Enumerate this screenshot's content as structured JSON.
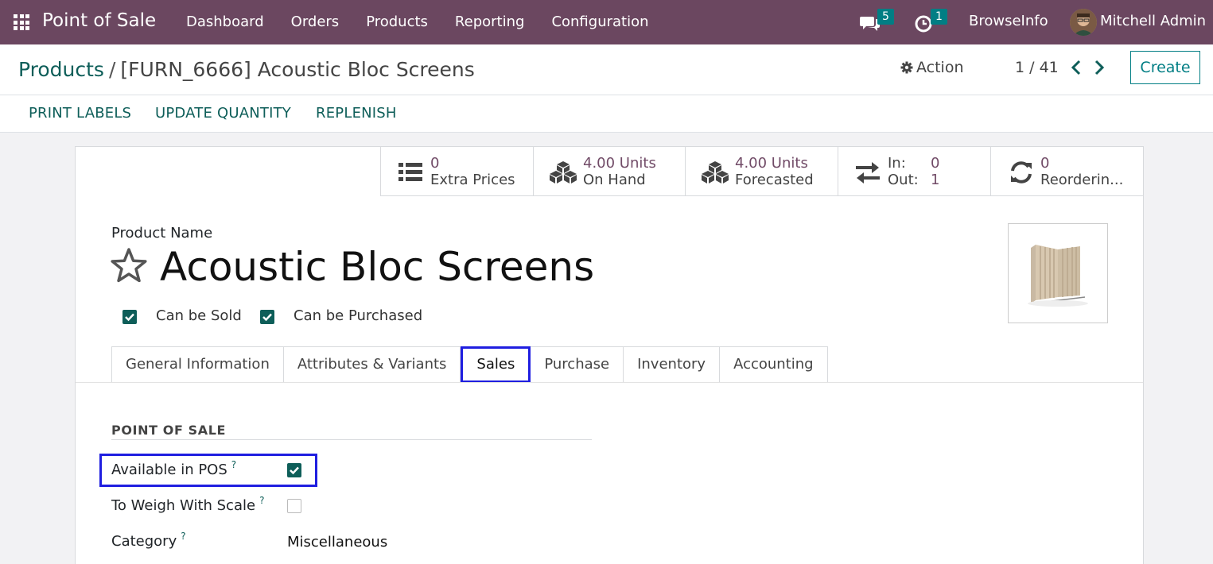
{
  "navbar": {
    "app_name": "Point of Sale",
    "menu": [
      "Dashboard",
      "Orders",
      "Products",
      "Reporting",
      "Configuration"
    ],
    "messages_count": "5",
    "activities_count": "1",
    "company": "BrowseInfo",
    "user": "Mitchell Admin"
  },
  "control_panel": {
    "breadcrumb_root": "Products",
    "breadcrumb_sep": "/",
    "breadcrumb_current": "[FURN_6666] Acoustic Bloc Screens",
    "action_label": "Action",
    "pager": "1 / 41",
    "create_label": "Create"
  },
  "action_bar": {
    "print_labels": "PRINT LABELS",
    "update_quantity": "UPDATE QUANTITY",
    "replenish": "REPLENISH"
  },
  "smart_buttons": {
    "extra_prices": {
      "value": "0",
      "label": "Extra Prices"
    },
    "on_hand": {
      "value": "4.00 Units",
      "label": "On Hand"
    },
    "forecasted": {
      "value": "4.00 Units",
      "label": "Forecasted"
    },
    "in_out": {
      "in_label": "In:",
      "in_value": "0",
      "out_label": "Out:",
      "out_value": "1"
    },
    "reordering": {
      "value": "0",
      "label": "Reorderin..."
    }
  },
  "product": {
    "name_label": "Product Name",
    "name": "Acoustic Bloc Screens",
    "can_be_sold": "Can be Sold",
    "can_be_purchased": "Can be Purchased"
  },
  "tabs": [
    "General Information",
    "Attributes & Variants",
    "Sales",
    "Purchase",
    "Inventory",
    "Accounting"
  ],
  "active_tab": "Sales",
  "pos_section": {
    "title": "POINT OF SALE",
    "available_in_pos": "Available in POS",
    "to_weigh": "To Weigh With Scale",
    "category_label": "Category",
    "category_value": "Miscellaneous",
    "help_mark": "?"
  },
  "colors": {
    "navbar": "#6b4760",
    "brand_teal": "#0e5e59",
    "highlight": "#1f1ee0",
    "smart_value": "#714b67"
  }
}
